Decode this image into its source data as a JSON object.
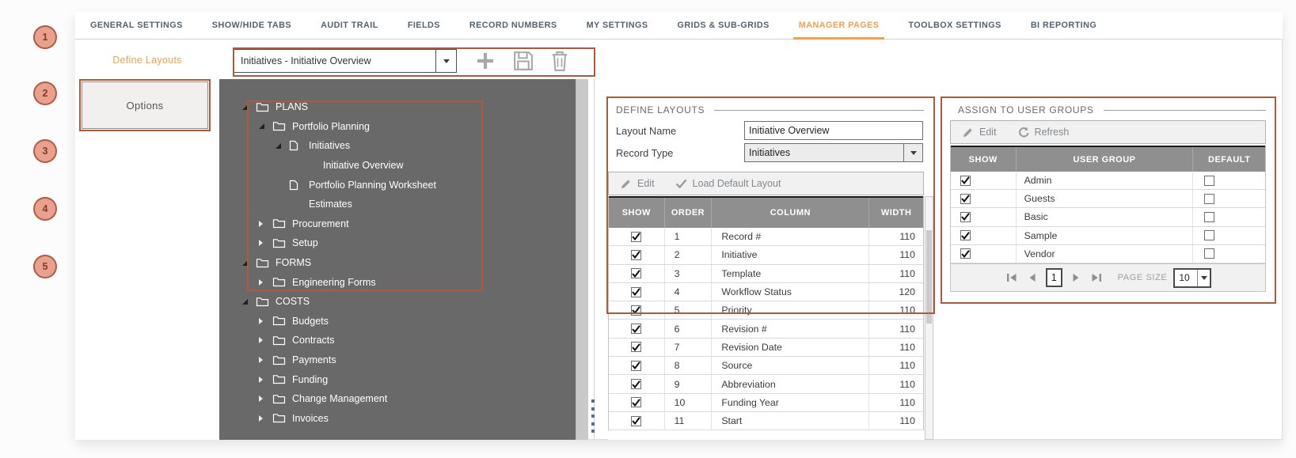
{
  "markers": [
    "1",
    "2",
    "3",
    "4",
    "5"
  ],
  "tabs": {
    "items": [
      {
        "label": "GENERAL SETTINGS",
        "active": false
      },
      {
        "label": "SHOW/HIDE TABS",
        "active": false
      },
      {
        "label": "AUDIT TRAIL",
        "active": false
      },
      {
        "label": "FIELDS",
        "active": false
      },
      {
        "label": "RECORD NUMBERS",
        "active": false
      },
      {
        "label": "MY SETTINGS",
        "active": false
      },
      {
        "label": "GRIDS & SUB-GRIDS",
        "active": false
      },
      {
        "label": "MANAGER PAGES",
        "active": true
      },
      {
        "label": "TOOLBOX SETTINGS",
        "active": false
      },
      {
        "label": "BI REPORTING",
        "active": false
      }
    ]
  },
  "sidebar": {
    "active_item": "Define Layouts",
    "options_button": "Options"
  },
  "layout_toolbar": {
    "selected_layout": "Initiatives - Initiative Overview",
    "icons": [
      "add-icon",
      "save-icon",
      "delete-icon"
    ]
  },
  "tree": {
    "items": [
      {
        "label": "PLANS",
        "level": 0,
        "toggle": "expanded",
        "icon": "folder"
      },
      {
        "label": "Portfolio Planning",
        "level": 1,
        "toggle": "expanded",
        "icon": "folder"
      },
      {
        "label": "Initiatives",
        "level": 2,
        "toggle": "expanded",
        "icon": "page"
      },
      {
        "label": "Initiative Overview",
        "level": 3,
        "toggle": "none",
        "icon": "none"
      },
      {
        "label": "Portfolio Planning Worksheet",
        "level": 2,
        "toggle": "none",
        "icon": "page"
      },
      {
        "label": "Estimates",
        "level": 2,
        "toggle": "none",
        "icon": "blank"
      },
      {
        "label": "Procurement",
        "level": 1,
        "toggle": "collapsed",
        "icon": "folder"
      },
      {
        "label": "Setup",
        "level": 1,
        "toggle": "collapsed",
        "icon": "folder"
      },
      {
        "label": "FORMS",
        "level": 0,
        "toggle": "expanded",
        "icon": "folder"
      },
      {
        "label": "Engineering Forms",
        "level": 1,
        "toggle": "collapsed",
        "icon": "folder"
      },
      {
        "label": "COSTS",
        "level": 0,
        "toggle": "expanded",
        "icon": "folder"
      },
      {
        "label": "Budgets",
        "level": 1,
        "toggle": "collapsed",
        "icon": "folder"
      },
      {
        "label": "Contracts",
        "level": 1,
        "toggle": "collapsed",
        "icon": "folder"
      },
      {
        "label": "Payments",
        "level": 1,
        "toggle": "collapsed",
        "icon": "folder"
      },
      {
        "label": "Funding",
        "level": 1,
        "toggle": "collapsed",
        "icon": "folder"
      },
      {
        "label": "Change Management",
        "level": 1,
        "toggle": "collapsed",
        "icon": "folder"
      },
      {
        "label": "Invoices",
        "level": 1,
        "toggle": "collapsed",
        "icon": "folder"
      }
    ]
  },
  "define_layouts": {
    "title": "DEFINE LAYOUTS",
    "layout_name_label": "Layout Name",
    "layout_name_value": "Initiative Overview",
    "record_type_label": "Record Type",
    "record_type_value": "Initiatives",
    "toolbar": {
      "edit": "Edit",
      "load_default": "Load Default Layout"
    },
    "table": {
      "columns": [
        "SHOW",
        "ORDER",
        "COLUMN",
        "WIDTH"
      ],
      "rows": [
        {
          "show": true,
          "order": "1",
          "column": "Record #",
          "width": "110"
        },
        {
          "show": true,
          "order": "2",
          "column": "Initiative",
          "width": "110"
        },
        {
          "show": true,
          "order": "3",
          "column": "Template",
          "width": "110"
        },
        {
          "show": true,
          "order": "4",
          "column": "Workflow Status",
          "width": "120"
        },
        {
          "show": true,
          "order": "5",
          "column": "Priority",
          "width": "110"
        },
        {
          "show": true,
          "order": "6",
          "column": "Revision #",
          "width": "110"
        },
        {
          "show": true,
          "order": "7",
          "column": "Revision Date",
          "width": "110"
        },
        {
          "show": true,
          "order": "8",
          "column": "Source",
          "width": "110"
        },
        {
          "show": true,
          "order": "9",
          "column": "Abbreviation",
          "width": "110"
        },
        {
          "show": true,
          "order": "10",
          "column": "Funding Year",
          "width": "110"
        },
        {
          "show": true,
          "order": "11",
          "column": "Start",
          "width": "110"
        }
      ]
    }
  },
  "assign_user_groups": {
    "title": "ASSIGN TO USER GROUPS",
    "toolbar": {
      "edit": "Edit",
      "refresh": "Refresh"
    },
    "table": {
      "columns": [
        "SHOW",
        "USER GROUP",
        "DEFAULT"
      ],
      "rows": [
        {
          "show": true,
          "group": "Admin",
          "default": false
        },
        {
          "show": true,
          "group": "Guests",
          "default": false
        },
        {
          "show": true,
          "group": "Basic",
          "default": false
        },
        {
          "show": true,
          "group": "Sample",
          "default": false
        },
        {
          "show": true,
          "group": "Vendor",
          "default": false
        }
      ]
    },
    "pager": {
      "page": "1",
      "page_size_label": "PAGE SIZE",
      "page_size": "10"
    }
  },
  "colors": {
    "accent": "#F2A14C",
    "annotation": "#AF5B3B",
    "marker_fill": "#E9A18D",
    "tree_bg": "#696969",
    "grid_header_bg": "#8F8F8F"
  }
}
